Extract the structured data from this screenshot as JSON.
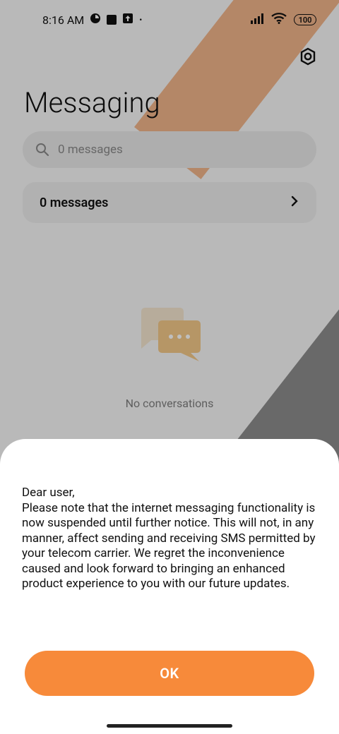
{
  "statusbar": {
    "time": "8:16 AM",
    "battery": "100",
    "indicators": [
      "signal-icon",
      "wifi-icon"
    ]
  },
  "app": {
    "title": "Messaging",
    "search_placeholder": "0 messages",
    "folder_label": "0 messages",
    "empty_text": "No conversations"
  },
  "dialog": {
    "message": "Dear user,\nPlease note that the internet messaging functionality is now suspended until further notice. This will not, in any manner, affect sending and receiving SMS permitted by your telecom carrier. We regret the inconvenience caused and look forward to bringing an enhanced product experience to you with our future updates.",
    "ok_label": "OK"
  },
  "colors": {
    "accent": "#f78a3a"
  }
}
